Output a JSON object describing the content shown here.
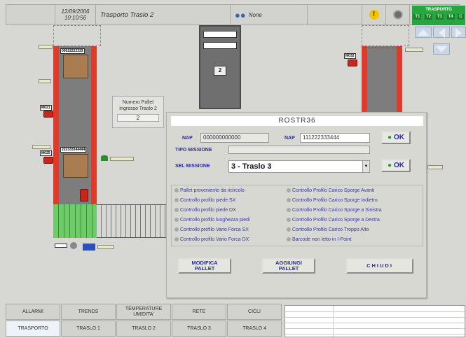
{
  "header": {
    "date": "12/09/2006",
    "time": "10:10:56",
    "title": "Trasporto Traslo 2",
    "user": "None"
  },
  "trasporto": {
    "label": "TRASPORTO",
    "items": [
      "T1",
      "T2",
      "T3",
      "T4",
      "C"
    ]
  },
  "plant": {
    "pallet_code_top": "00022222333",
    "pallet_code_mid": "222333344444",
    "motor_labels": [
      "M021",
      "M025",
      "M032"
    ],
    "numero_pallet": {
      "label": "Numero Pallet Ingresso Traslo 2",
      "value": "2"
    },
    "lift_number": "2"
  },
  "panel": {
    "title": "ROSTR36",
    "nap1_label": "NAP",
    "nap1_value": "000000000000",
    "nap2_label": "NAP",
    "nap2_value": "111222333444",
    "ok_label": "OK",
    "tipo_label": "TIPO MISSIONE",
    "sel_label": "SEL MISSIONE",
    "sel_value": "3 - Traslo 3",
    "checks_left": [
      "Pallet proveniente da ricircolo",
      "Controllo profilo piede SX",
      "Controllo profilo piede DX",
      "Controllo profilo lunghezza piedi",
      "Controllo profilo Vario Forca SX",
      "Controllo profilo Vario Forca DX"
    ],
    "checks_right": [
      "Controllo Profilo Carico Sporge Avanti",
      "Controllo Profilo Carico Sporge Indietro",
      "Controllo Profilo Carico Sporge a Sinistra",
      "Controllo Profilo Carico Sporge a Destra",
      "Controllo Profilo Carico Troppo Alto",
      "Barcode non letto in I-Point"
    ],
    "btn_modifica": [
      "MODIFICA",
      "PALLET"
    ],
    "btn_aggiungi": [
      "AGGIUNGI",
      "PALLET"
    ],
    "btn_chiudi": "CHIUDI"
  },
  "nav": {
    "row1": [
      "ALLARMI",
      "TRENDS",
      "TEMPERATURE UMIDITA'",
      "RETE",
      "CICLI"
    ],
    "row2": [
      "TRASPORTO",
      "TRASLO 1",
      "TRASLO 2",
      "TRASLO 3",
      "TRASLO 4"
    ]
  }
}
